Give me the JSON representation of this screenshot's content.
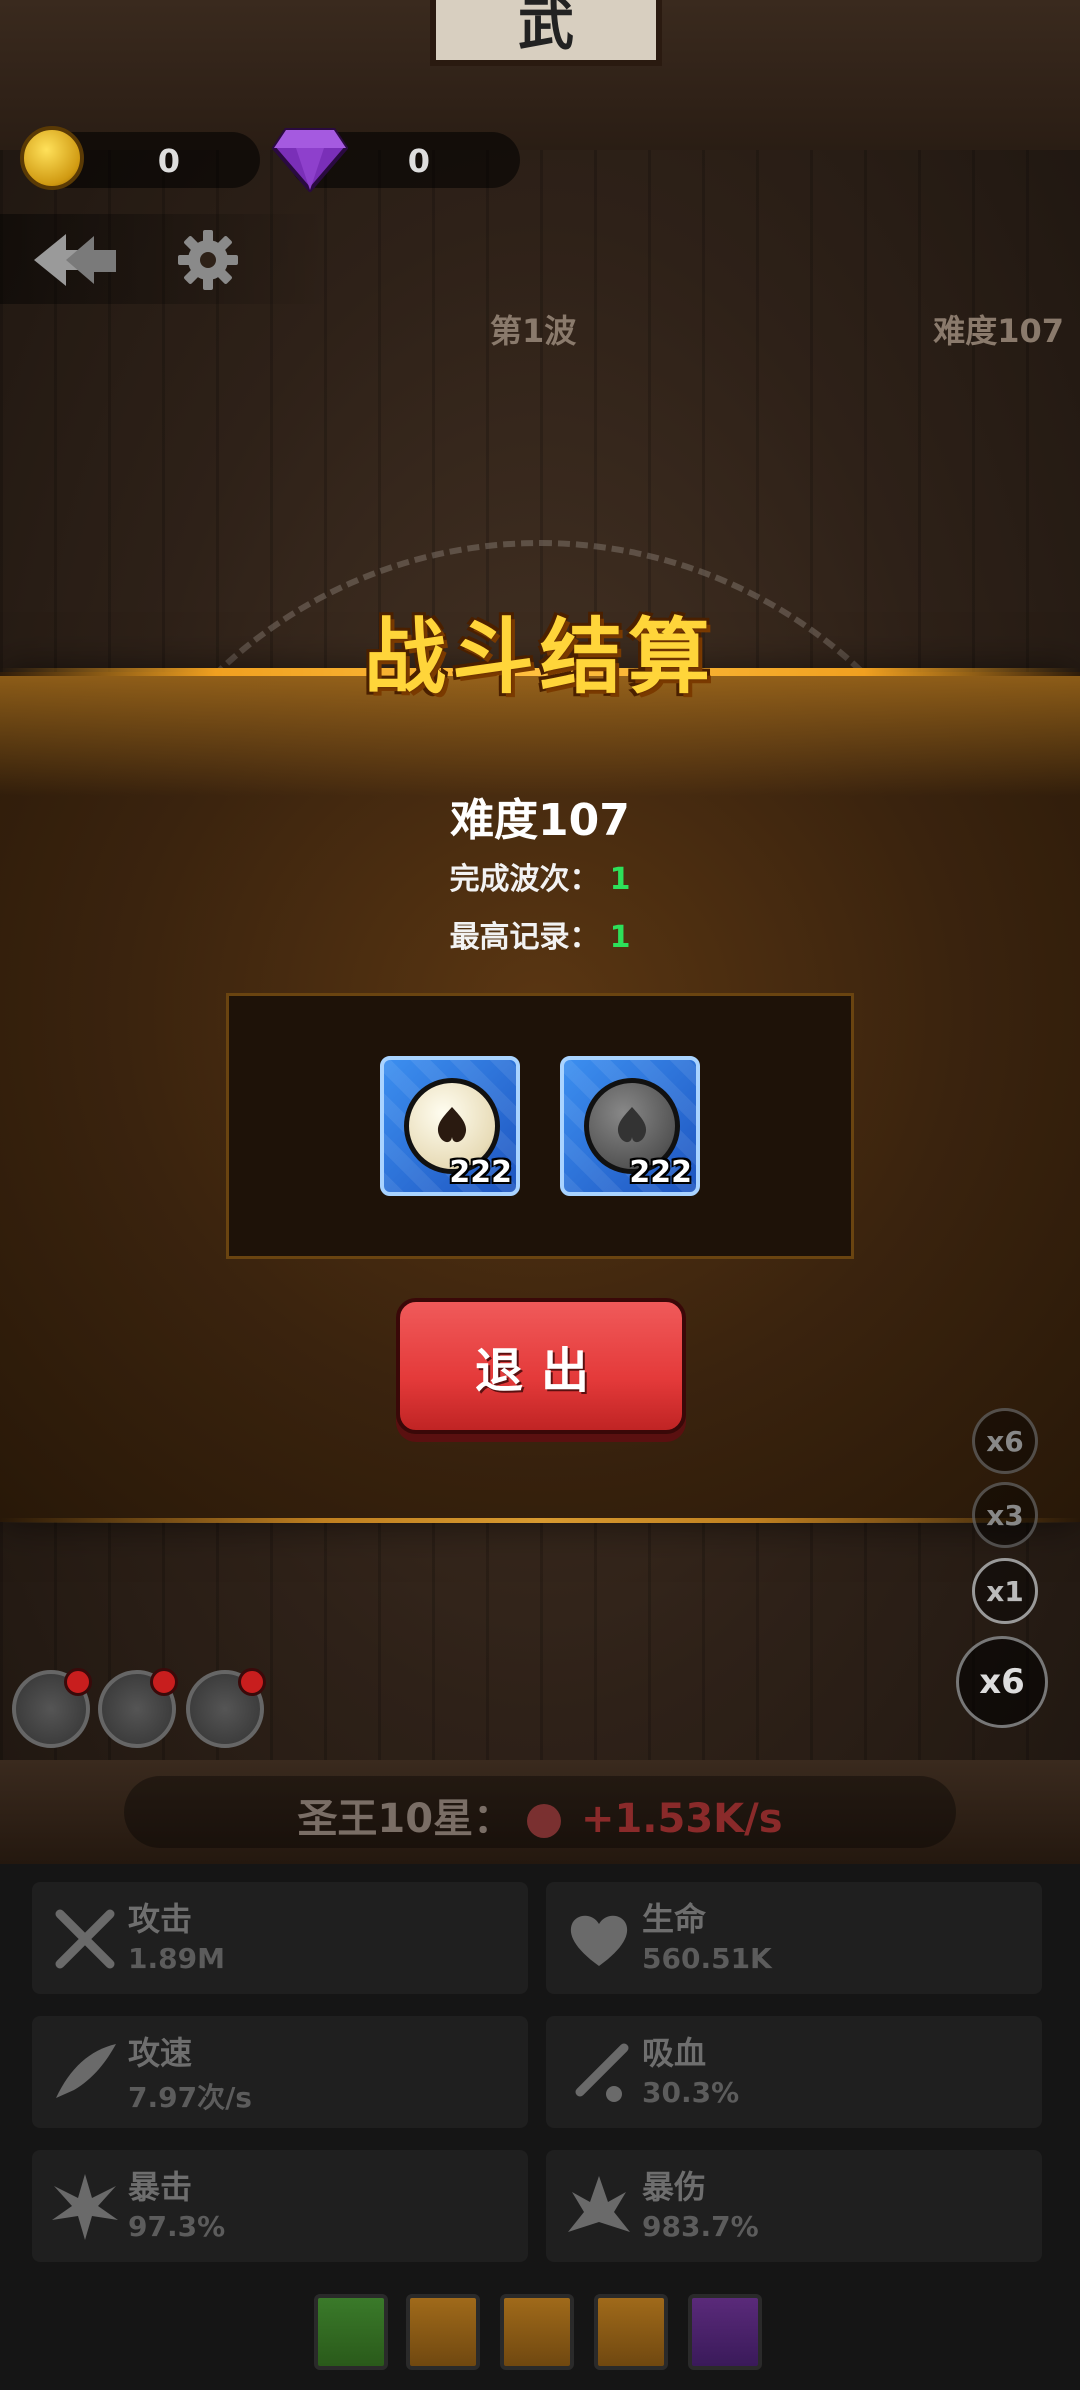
{
  "header": {
    "sign_char": "武",
    "coins": "0",
    "gems": "0",
    "wave": "第1波",
    "difficulty": "难度107"
  },
  "result": {
    "title": "战斗结算",
    "difficulty": "难度107",
    "waves_label": "完成波次：",
    "waves_value": "1",
    "record_label": "最高记录：",
    "record_value": "1",
    "rewards": [
      {
        "icon": "light-orb-icon",
        "count": "222"
      },
      {
        "icon": "dark-orb-icon",
        "count": "222"
      }
    ],
    "exit_label": "退出"
  },
  "speed": {
    "options": [
      "x6",
      "x3",
      "x1"
    ],
    "current": "x6"
  },
  "rank": {
    "label": "圣王10星：",
    "rate": "+1.53K/s"
  },
  "stats": [
    {
      "name": "攻击",
      "value": "1.89M",
      "icon": "crossed-swords-icon"
    },
    {
      "name": "生命",
      "value": "560.51K",
      "icon": "heart-icon"
    },
    {
      "name": "攻速",
      "value": "7.97次/s",
      "icon": "wing-icon"
    },
    {
      "name": "吸血",
      "value": "30.3%",
      "icon": "blood-sword-icon"
    },
    {
      "name": "暴击",
      "value": "97.3%",
      "icon": "crit-burst-icon"
    },
    {
      "name": "暴伤",
      "value": "983.7%",
      "icon": "crit-damage-icon"
    }
  ],
  "colors": {
    "accent_gold": "#ffd53a",
    "highlight_green": "#2de05a",
    "exit_red": "#e43a3a",
    "reward_blue": "#3c8ff0"
  }
}
